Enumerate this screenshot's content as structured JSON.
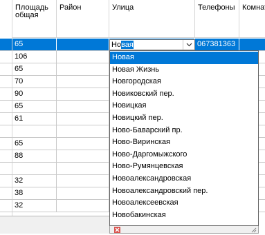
{
  "columns": [
    {
      "label_line1": "Площадь",
      "label_line2": "общая"
    },
    {
      "label_line1": "Район",
      "label_line2": ""
    },
    {
      "label_line1": "Улица",
      "label_line2": ""
    },
    {
      "label_line1": "Телефоны",
      "label_line2": ""
    },
    {
      "label_line1": "Комнаты",
      "label_line2": ""
    }
  ],
  "rows": [
    {
      "area": "65",
      "district": "",
      "street": "",
      "phones": "067381363",
      "rooms": ""
    },
    {
      "area": "106",
      "district": "",
      "street": "",
      "phones": "",
      "rooms": ""
    },
    {
      "area": "65",
      "district": "",
      "street": "",
      "phones": "",
      "rooms": ""
    },
    {
      "area": "70",
      "district": "",
      "street": "",
      "phones": "",
      "rooms": ""
    },
    {
      "area": "90",
      "district": "",
      "street": "",
      "phones": "",
      "rooms": ""
    },
    {
      "area": "65",
      "district": "",
      "street": "",
      "phones": "",
      "rooms": ""
    },
    {
      "area": "61",
      "district": "",
      "street": "",
      "phones": "",
      "rooms": ""
    },
    {
      "area": "",
      "district": "",
      "street": "",
      "phones": "",
      "rooms": ""
    },
    {
      "area": "65",
      "district": "",
      "street": "",
      "phones": "",
      "rooms": ""
    },
    {
      "area": "88",
      "district": "",
      "street": "",
      "phones": "",
      "rooms": ""
    },
    {
      "area": "",
      "district": "",
      "street": "",
      "phones": "",
      "rooms": ""
    },
    {
      "area": "32",
      "district": "",
      "street": "",
      "phones": "",
      "rooms": ""
    },
    {
      "area": "38",
      "district": "",
      "street": "",
      "phones": "",
      "rooms": ""
    },
    {
      "area": "32",
      "district": "",
      "street": "",
      "phones": "",
      "rooms": ""
    }
  ],
  "editor": {
    "typed": "Но",
    "autocomplete": "вая"
  },
  "dropdown_options": [
    "Новая",
    "Новая Жизнь",
    "Новгородская",
    "Новиковский пер.",
    "Новицкая",
    "Новицкий пер.",
    "Ново-Баварский пр.",
    "Ново-Виринская",
    "Ново-Даргомыжского",
    "Ново-Румянцевская",
    "Новоалександровская",
    "Новоалександровский пер.",
    "Новоалексеевская",
    "Новобакинская"
  ],
  "selected_option_index": 0,
  "colors": {
    "selection": "#0078d7",
    "grid_line": "#c9c9c9",
    "close_button": "#d9534f"
  },
  "icons": {
    "editor_arrow": "chevron-down-icon",
    "close": "close-icon",
    "resize": "resize-grip-icon"
  }
}
